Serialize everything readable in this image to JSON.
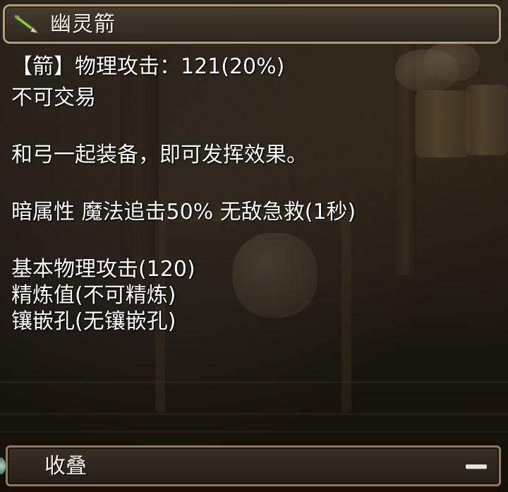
{
  "item": {
    "name": "幽灵箭",
    "icon": "arrow-icon"
  },
  "lines": [
    "【箭】物理攻击：121(20%)",
    "不可交易",
    "和弓一起装备，即可发挥效果。",
    "暗属性 魔法追击50% 无敌急救(1秒)",
    "基本物理攻击(120)",
    "精炼值(不可精炼)",
    "镶嵌孔(无镶嵌孔)"
  ],
  "footer": {
    "collapse_label": "收叠",
    "collapse_icon": "minus-icon"
  },
  "colors": {
    "text": "#ffffff",
    "title_text": "#f5f1e6",
    "frame_border": "#b19d7b"
  }
}
